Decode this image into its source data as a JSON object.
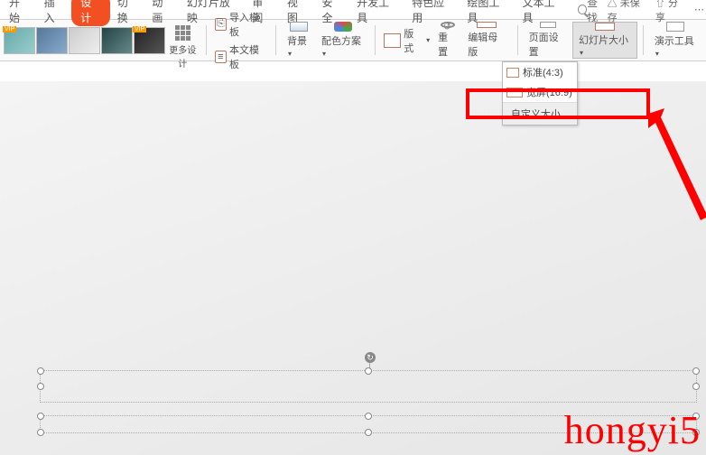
{
  "tabs": {
    "start": "开始",
    "insert": "插入",
    "design": "设计",
    "transition": "切换",
    "animation": "动画",
    "slideshow": "幻灯片放映",
    "review": "审阅",
    "view": "视图",
    "security": "安全",
    "devtools": "开发工具",
    "special": "特色应用",
    "drawing": "绘图工具",
    "texttools": "文本工具"
  },
  "topright": {
    "search": "查找",
    "unsaved": "未保存",
    "share": "分享"
  },
  "ribbon": {
    "more_design": "更多设计",
    "import_template": "导入模板",
    "this_template": "本文模板",
    "background": "背景",
    "color_scheme": "配色方案",
    "layout": "版式",
    "reset": "重置",
    "edit_master": "编辑母版",
    "page_setup": "页面设置",
    "slide_size": "幻灯片大小",
    "present_tools": "演示工具"
  },
  "dropdown": {
    "standard": "标准(4:3)",
    "widescreen": "宽屏(16:9)",
    "custom_size": "自定义大小..."
  },
  "watermark": "hongyi5"
}
